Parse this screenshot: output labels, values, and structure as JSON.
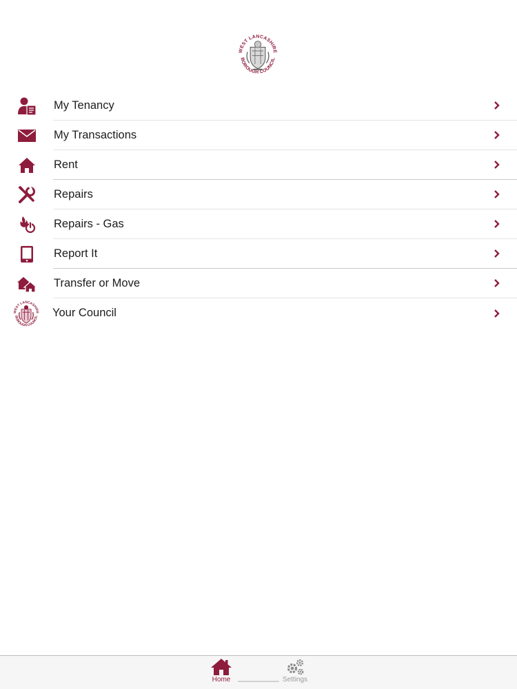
{
  "header": {
    "logo_text_top": "WEST LANCASHIRE",
    "logo_text_bottom": "BOROUGH COUNCIL"
  },
  "colors": {
    "brand": "#8e1c3c",
    "divider": "#e4e4e4",
    "tabbar_bg": "#f6f6f7",
    "inactive": "#9a9a9a"
  },
  "menu": {
    "items": [
      {
        "label": "My Tenancy",
        "icon": "tenancy-icon"
      },
      {
        "label": "My Transactions",
        "icon": "envelope-icon"
      },
      {
        "label": "Rent",
        "icon": "house-icon"
      },
      {
        "label": "Repairs",
        "icon": "tools-icon"
      },
      {
        "label": "Repairs - Gas",
        "icon": "gas-power-icon"
      },
      {
        "label": "Report It",
        "icon": "tablet-icon"
      },
      {
        "label": "Transfer or Move",
        "icon": "houses-icon"
      },
      {
        "label": "Your Council",
        "icon": "council-crest-icon"
      }
    ]
  },
  "tabbar": {
    "home_label": "Home",
    "settings_label": "Settings",
    "active": "Home"
  }
}
